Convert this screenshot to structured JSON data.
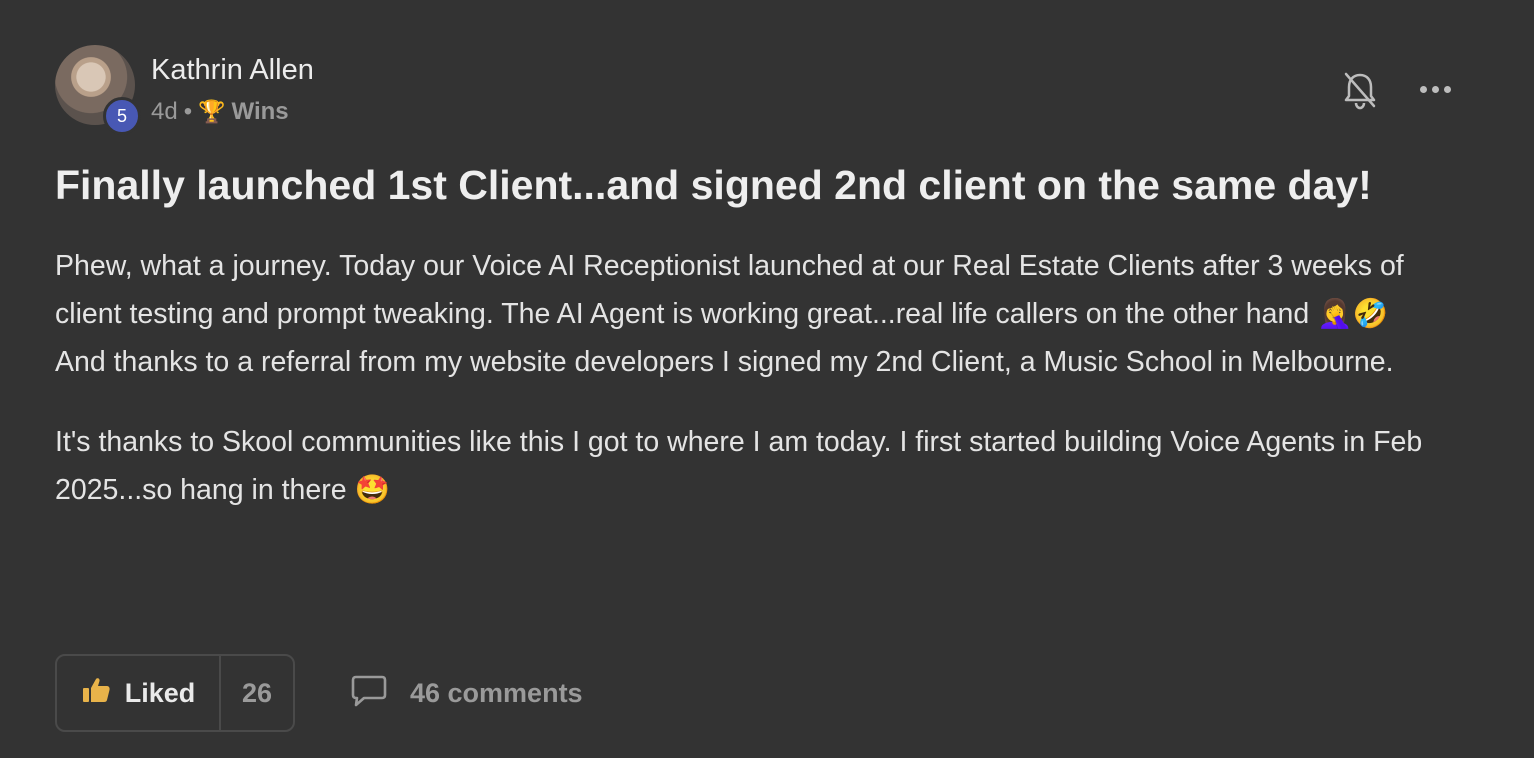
{
  "author": {
    "name": "Kathrin Allen",
    "level": "5"
  },
  "meta": {
    "time": "4d",
    "separator": "•",
    "category_icon": "trophy-icon",
    "category": "Wins"
  },
  "post": {
    "title": "Finally launched 1st Client...and signed 2nd client on the same day!",
    "paragraphs": [
      "Phew, what a journey. Today our Voice AI Receptionist launched at our Real Estate Clients after 3 weeks of client testing and prompt tweaking. The AI Agent is working great...real life callers on the other hand 🤦‍♀️🤣",
      "And thanks to a referral from my website developers I signed my 2nd Client, a Music School in Melbourne.",
      "It's thanks to Skool communities like this I got to where I am today. I first started building Voice Agents in Feb 2025...so hang in there 🤩"
    ]
  },
  "actions": {
    "like_label": "Liked",
    "like_count": "26",
    "comments_label": "46 comments"
  },
  "icons": {
    "bell": "bell-off-icon",
    "more": "more-dots-icon",
    "like": "thumbs-up-icon",
    "comment": "comment-bubble-icon"
  },
  "colors": {
    "background": "#333333",
    "badge": "#4858b4",
    "thumb": "#e8b34a"
  }
}
